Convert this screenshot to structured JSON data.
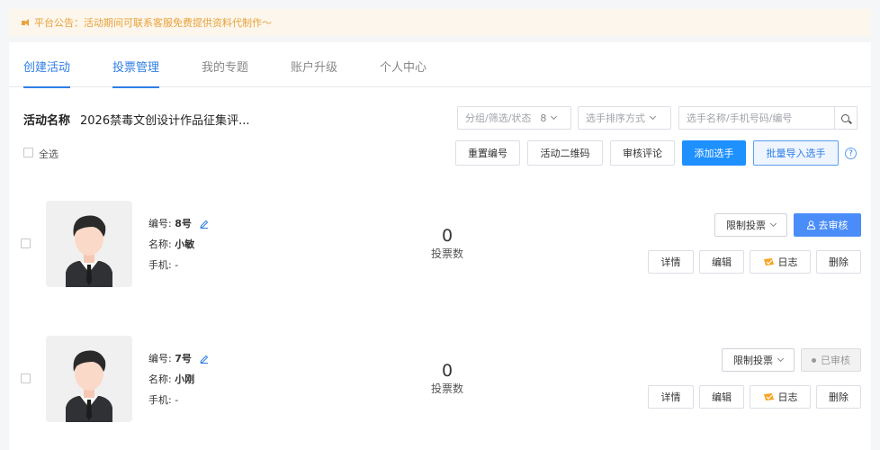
{
  "notice": {
    "text": "平台公告：活动期间可联系客服免费提供资料代制作～"
  },
  "tabs": [
    {
      "label": "创建活动",
      "active": true
    },
    {
      "label": "投票管理",
      "active": true
    },
    {
      "label": "我的专题",
      "active": false
    },
    {
      "label": "账户升级",
      "active": false
    },
    {
      "label": "个人中心",
      "active": false
    }
  ],
  "activity": {
    "label": "活动名称",
    "name": "2026禁毒文创设计作品征集评..."
  },
  "filters": {
    "group": {
      "label": "分组/筛选/状态",
      "count": "8"
    },
    "sort": {
      "label": "选手排序方式"
    },
    "search": {
      "placeholder": "选手名称/手机号码/编号"
    }
  },
  "toolbar": {
    "select_all": "全选",
    "reset_number": "重置编号",
    "qr_code": "活动二维码",
    "review_comments": "审核评论",
    "add_player": "添加选手",
    "batch_import": "批量导入选手",
    "help": "?"
  },
  "players": [
    {
      "number_label": "编号:",
      "number": "8号",
      "name_label": "名称:",
      "name": "小敏",
      "phone_label": "手机:",
      "phone": "-",
      "votes": "0",
      "votes_label": "投票数",
      "limit_label": "限制投票",
      "review_label": "去审核",
      "reviewed": false,
      "actions": {
        "detail": "详情",
        "edit": "编辑",
        "log": "日志",
        "delete": "删除"
      }
    },
    {
      "number_label": "编号:",
      "number": "7号",
      "name_label": "名称:",
      "name": "小刚",
      "phone_label": "手机:",
      "phone": "-",
      "votes": "0",
      "votes_label": "投票数",
      "limit_label": "限制投票",
      "review_label": "已审核",
      "reviewed": true,
      "actions": {
        "detail": "详情",
        "edit": "编辑",
        "log": "日志",
        "delete": "删除"
      }
    }
  ],
  "colors": {
    "accent": "#2f7ee6",
    "primary_button": "#1e90ff",
    "notice_text": "#e6a23c",
    "notice_bg": "#fdf6ec"
  }
}
